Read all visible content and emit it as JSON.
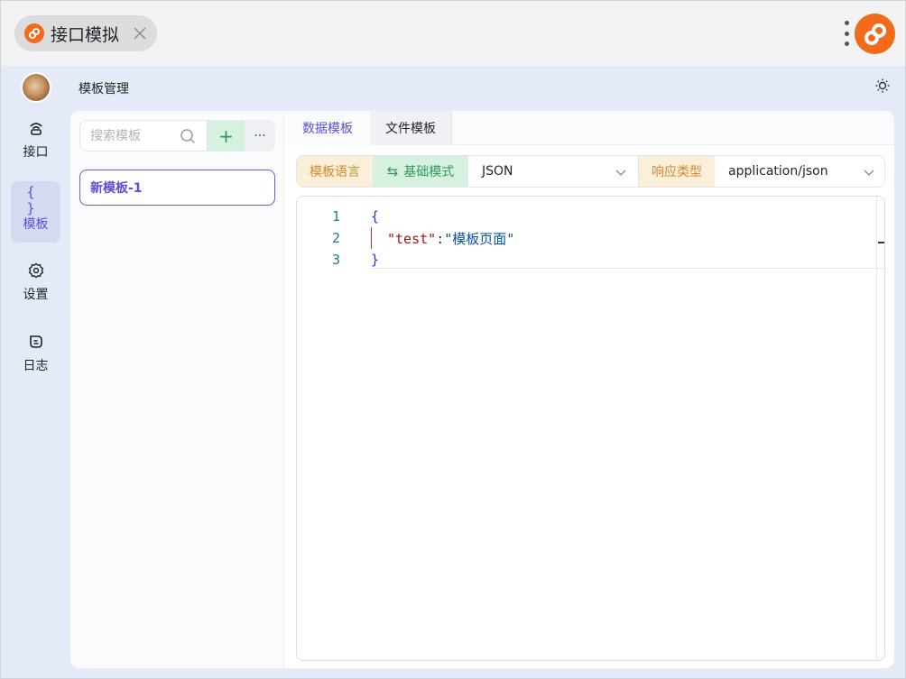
{
  "app": {
    "tab_title": "接口模拟"
  },
  "sidebar": {
    "items": [
      {
        "label": "接口",
        "icon": "broadcast-icon"
      },
      {
        "label": "模板",
        "icon": "braces-icon",
        "glyph": "{ }"
      },
      {
        "label": "设置",
        "icon": "gear-icon"
      },
      {
        "label": "日志",
        "icon": "log-icon"
      }
    ],
    "active_index": 1
  },
  "header": {
    "page_title": "模板管理"
  },
  "templates": {
    "search_placeholder": "搜索模板",
    "add_label": "+",
    "more_label": "···",
    "items": [
      {
        "name": "新模板-1"
      }
    ]
  },
  "tabs": [
    {
      "label": "数据模板",
      "active": true
    },
    {
      "label": "文件模板",
      "active": false
    }
  ],
  "toolbar": {
    "lang_label": "模板语言",
    "mode_icon": "⇆",
    "mode_label": "基础模式",
    "language_value": "JSON",
    "response_label": "响应类型",
    "response_value": "application/json"
  },
  "editor": {
    "line_numbers": [
      "1",
      "2",
      "3"
    ],
    "open_brace": "{",
    "key": "\"test\"",
    "colon": ":",
    "value": "\"模板页面\"",
    "close_brace": "}"
  },
  "colors": {
    "accent": "#5b4fd8",
    "brand": "#f26a1b",
    "green": "#2c9a5a",
    "orange": "#d08a2c"
  }
}
